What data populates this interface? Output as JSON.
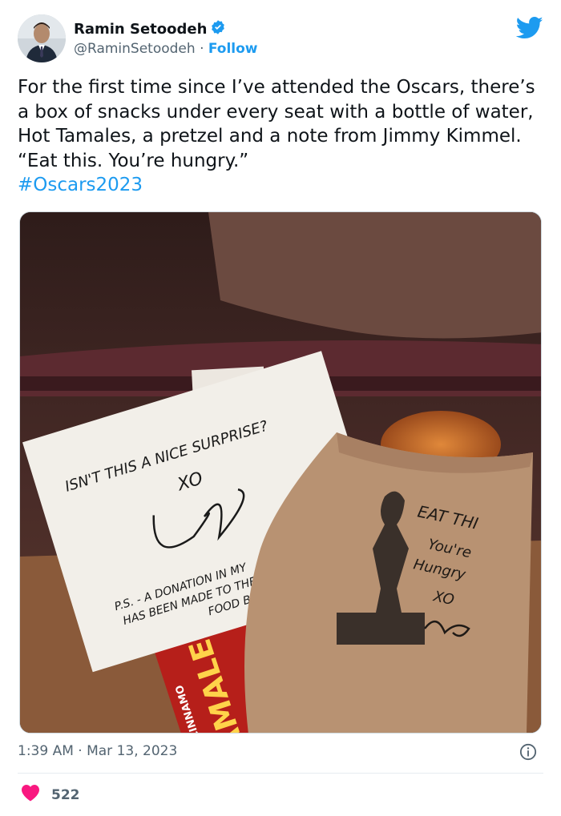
{
  "author": {
    "name": "Ramin Setoodeh",
    "handle": "@RaminSetoodeh",
    "separator": "·",
    "follow_label": "Follow",
    "verified": true
  },
  "tweet": {
    "text": "For the first time since I’ve attended the Oscars, there’s a box of snacks under every seat with a bottle of water, Hot Tamales, a pretzel and a note from Jimmy Kimmel. “Eat this. You’re hungry.”",
    "hashtag": "#Oscars2023",
    "timestamp": "1:39 AM · Mar 13, 2023"
  },
  "photo": {
    "note_line1": "ISN'T THIS A NICE SURPRISE?",
    "note_xo": "XO",
    "note_ps1": "P.S. - A DONATION IN MY",
    "note_ps2": "HAS BEEN MADE TO THE L",
    "note_ps3": "FOOD BANK",
    "bag_line1": "EAT THI",
    "bag_line2": "You're",
    "bag_line3": "Hungry",
    "bag_xo": "XO",
    "candy_brand": "TAMALES",
    "candy_flavor": "CINNAMO"
  },
  "engagement": {
    "likes": "522"
  },
  "colors": {
    "twitter_blue": "#1d9bf0",
    "like_red": "#f91880",
    "text_primary": "#0f1419",
    "text_secondary": "#536471"
  },
  "icons": [
    "verified-badge-icon",
    "twitter-bird-icon",
    "info-icon",
    "heart-icon"
  ]
}
